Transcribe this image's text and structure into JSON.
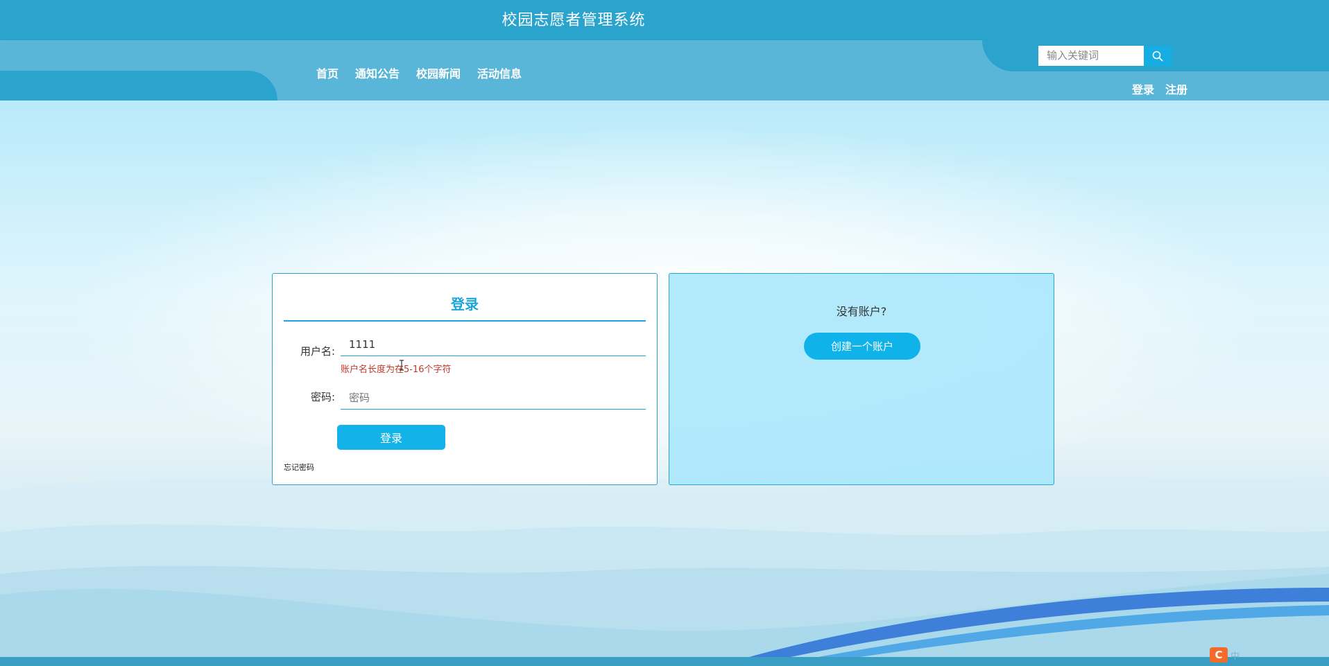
{
  "header": {
    "site_title": "校园志愿者管理系统",
    "nav": [
      {
        "label": "首页"
      },
      {
        "label": "通知公告"
      },
      {
        "label": "校园新闻"
      },
      {
        "label": "活动信息"
      }
    ],
    "search": {
      "placeholder": "输入关键词",
      "value": "",
      "icon": "search-icon"
    },
    "auth": {
      "login_label": "登录",
      "register_label": "注册"
    }
  },
  "login": {
    "title": "登录",
    "username": {
      "label": "用户名:",
      "value": "1111",
      "error": "账户名长度为在5-16个字符"
    },
    "password": {
      "label": "密码:",
      "placeholder": "密码",
      "value": ""
    },
    "submit_label": "登录",
    "forgot_label": "忘记密码"
  },
  "register": {
    "prompt": "没有账户?",
    "create_label": "创建一个账户"
  },
  "watermark": {
    "logo": "C",
    "text": "中"
  },
  "colors": {
    "header_primary": "#2aa3cd",
    "header_secondary": "#5ab6d8",
    "accent": "#1da5da",
    "button": "#13b2e8",
    "error": "#c0392b",
    "register_panel": "#a6e6fc"
  }
}
